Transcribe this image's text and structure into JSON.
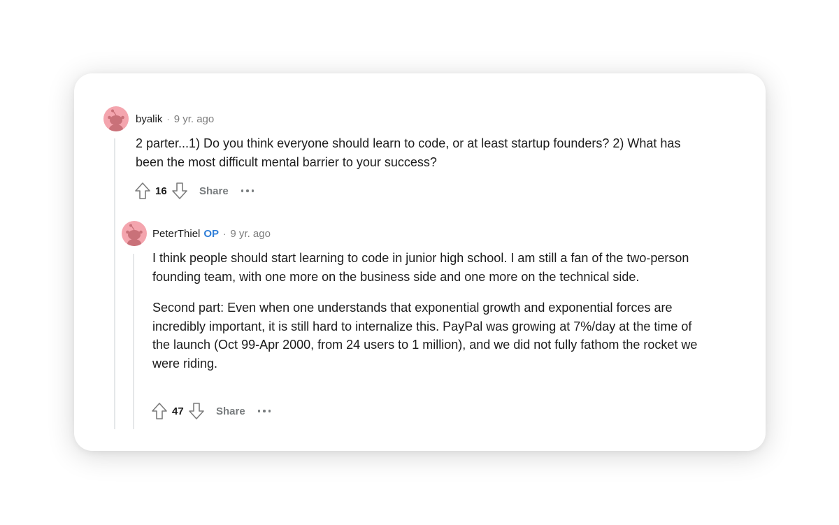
{
  "comments": [
    {
      "username": "byalik",
      "op_badge": "",
      "separator": "·",
      "time": "9 yr. ago",
      "paragraphs": [
        "2 parter...1) Do you think everyone should learn to code, or at least startup founders? 2) What has been the most difficult mental barrier to your success?"
      ],
      "score": "16",
      "share_label": "Share"
    },
    {
      "username": "PeterThiel",
      "op_badge": "OP",
      "separator": "·",
      "time": "9 yr. ago",
      "paragraphs": [
        "I think people should start learning to code in junior high school. I am still a fan of the two-person founding team, with one more on the business side and one more on the technical side.",
        "Second part: Even when one understands that exponential growth and exponential forces are incredibly important, it is still hard to internalize this. PayPal was growing at 7%/day at the time of the launch (Oct 99-Apr 2000, from 24 users to 1 million), and we did not fully fathom the rocket we were riding."
      ],
      "score": "47",
      "share_label": "Share"
    }
  ],
  "colors": {
    "avatar_bg": "#f4a5ae",
    "avatar_figure": "#c97179",
    "op_badge": "#2f7ed8",
    "muted_text": "#7c7c7c",
    "thread_line": "#e5e7e9"
  },
  "icons": {
    "avatar": "snoo-avatar-icon",
    "upvote": "upvote-arrow-icon",
    "downvote": "downvote-arrow-icon",
    "more": "more-options-icon"
  }
}
